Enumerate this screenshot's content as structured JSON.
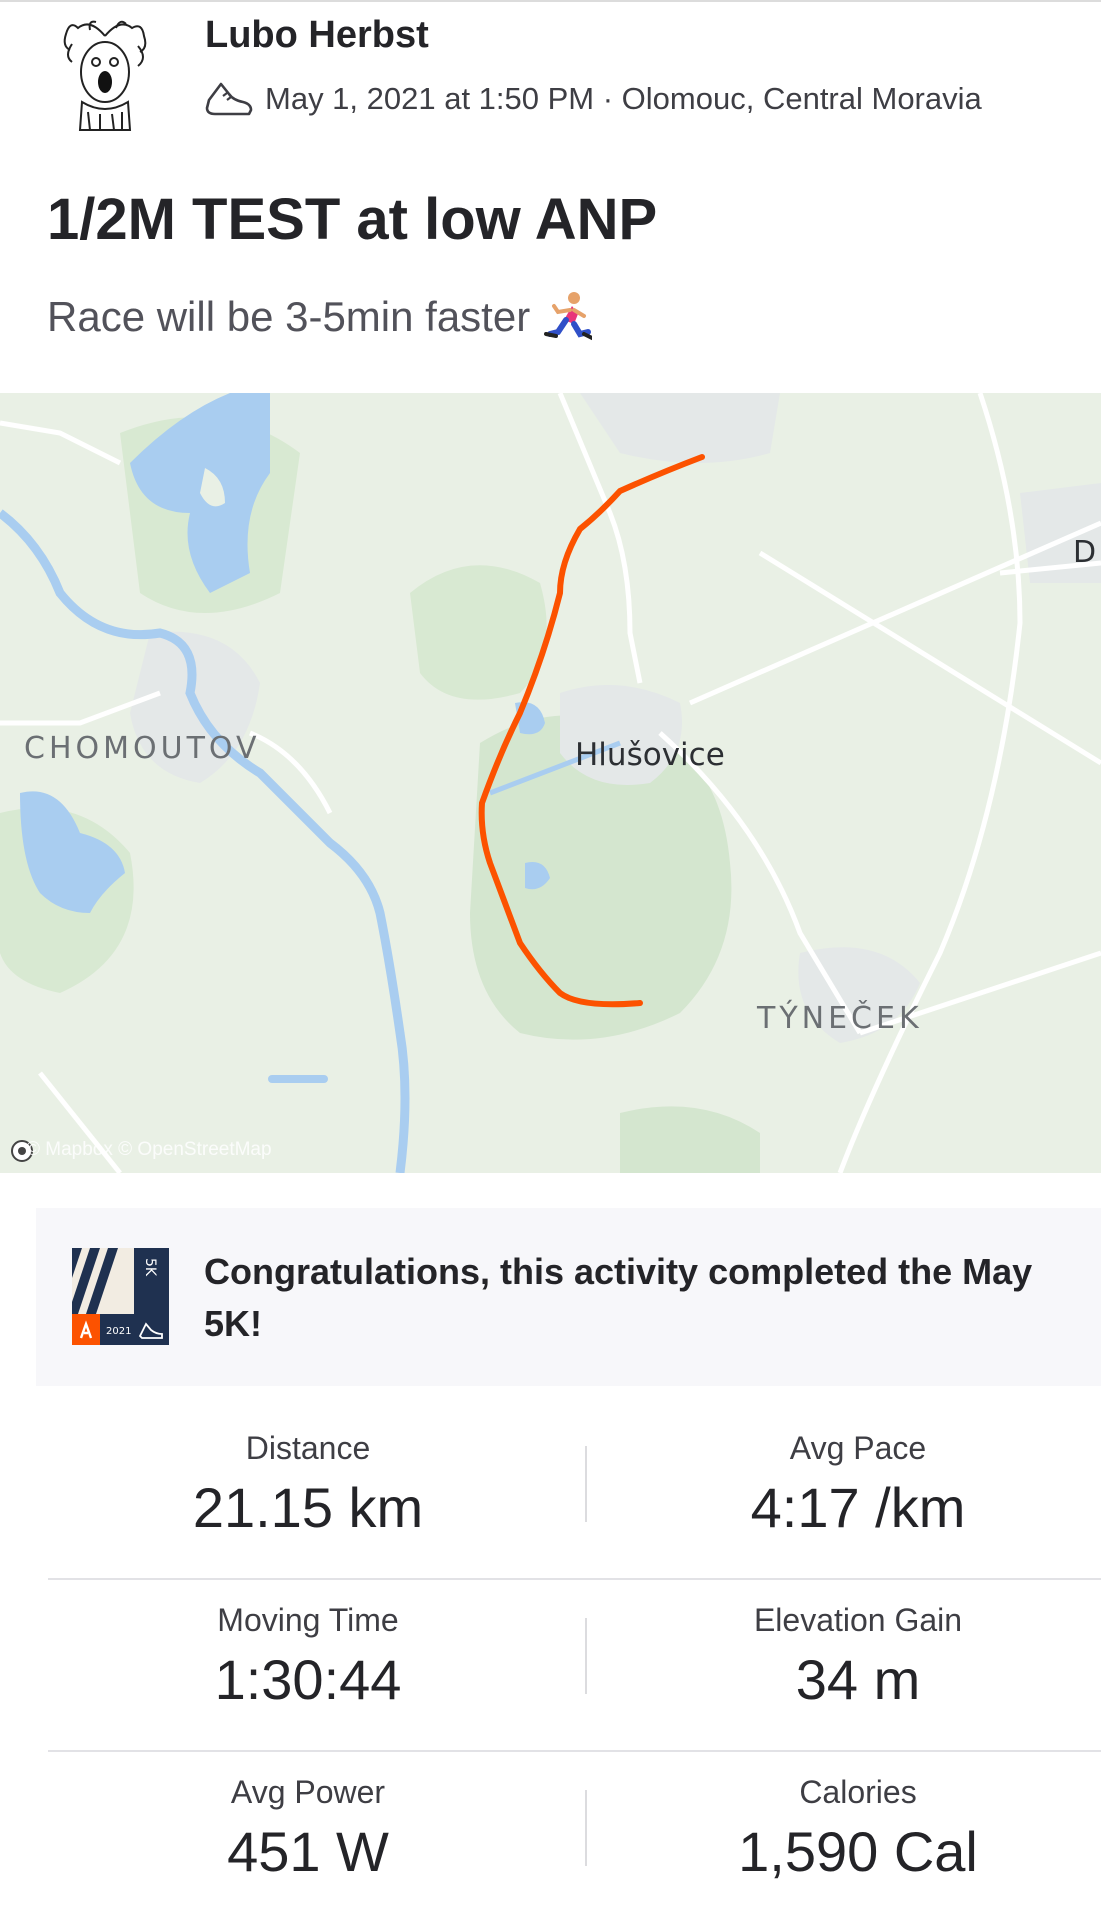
{
  "activity": {
    "athlete_name": "Lubo Herbst",
    "meta": "May 1, 2021 at 1:50 PM · Olomouc, Central Moravia",
    "sport_icon": "running-shoe-icon",
    "title": "1/2M TEST at low ANP",
    "description": "Race will be 3-5min faster",
    "description_emoji": "person-running-icon"
  },
  "map": {
    "labels": {
      "chomoutov": "CHOMOUTOV",
      "husovice": "Hlušovice",
      "tynecek": "TÝNEČEK",
      "d": "D"
    },
    "attribution": "© Mapbox © OpenStreetMap",
    "route_color": "#fc5200"
  },
  "challenge": {
    "text": "Congratulations, this activity completed the May 5K!",
    "badge": {
      "label": "5K",
      "year": "2021"
    }
  },
  "stats": [
    {
      "label": "Distance",
      "value": "21.15 km"
    },
    {
      "label": "Avg Pace",
      "value": "4:17 /km"
    },
    {
      "label": "Moving Time",
      "value": "1:30:44"
    },
    {
      "label": "Elevation Gain",
      "value": "34 m"
    },
    {
      "label": "Avg Power",
      "value": "451 W"
    },
    {
      "label": "Calories",
      "value": "1,590 Cal"
    }
  ],
  "colors": {
    "brand": "#fc5200",
    "text": "#242428",
    "water": "#a9cdf0",
    "park": "#d4e6cf",
    "badge_navy": "#1f3150"
  }
}
